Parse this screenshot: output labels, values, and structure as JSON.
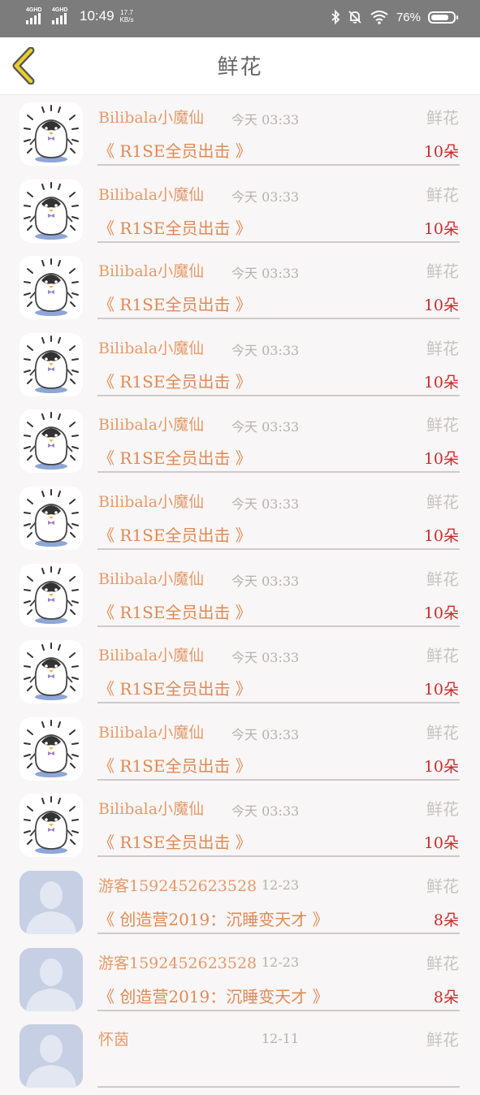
{
  "status_bar": {
    "network_1": "4GHD",
    "network_2": "4GHD",
    "time": "10:49",
    "speed_value": "17.7",
    "speed_unit": "KB/s",
    "battery": "76%"
  },
  "header": {
    "title": "鲜花"
  },
  "items": [
    {
      "name": "Bilibala小魔仙",
      "time": "今天 03:33",
      "kind": "鲜花",
      "show": "《 R1SE全员出击 》",
      "count": "10朵",
      "avatar": "penguin"
    },
    {
      "name": "Bilibala小魔仙",
      "time": "今天 03:33",
      "kind": "鲜花",
      "show": "《 R1SE全员出击 》",
      "count": "10朵",
      "avatar": "penguin"
    },
    {
      "name": "Bilibala小魔仙",
      "time": "今天 03:33",
      "kind": "鲜花",
      "show": "《 R1SE全员出击 》",
      "count": "10朵",
      "avatar": "penguin"
    },
    {
      "name": "Bilibala小魔仙",
      "time": "今天 03:33",
      "kind": "鲜花",
      "show": "《 R1SE全员出击 》",
      "count": "10朵",
      "avatar": "penguin"
    },
    {
      "name": "Bilibala小魔仙",
      "time": "今天 03:33",
      "kind": "鲜花",
      "show": "《 R1SE全员出击 》",
      "count": "10朵",
      "avatar": "penguin"
    },
    {
      "name": "Bilibala小魔仙",
      "time": "今天 03:33",
      "kind": "鲜花",
      "show": "《 R1SE全员出击 》",
      "count": "10朵",
      "avatar": "penguin"
    },
    {
      "name": "Bilibala小魔仙",
      "time": "今天 03:33",
      "kind": "鲜花",
      "show": "《 R1SE全员出击 》",
      "count": "10朵",
      "avatar": "penguin"
    },
    {
      "name": "Bilibala小魔仙",
      "time": "今天 03:33",
      "kind": "鲜花",
      "show": "《 R1SE全员出击 》",
      "count": "10朵",
      "avatar": "penguin"
    },
    {
      "name": "Bilibala小魔仙",
      "time": "今天 03:33",
      "kind": "鲜花",
      "show": "《 R1SE全员出击 》",
      "count": "10朵",
      "avatar": "penguin"
    },
    {
      "name": "Bilibala小魔仙",
      "time": "今天 03:33",
      "kind": "鲜花",
      "show": "《 R1SE全员出击 》",
      "count": "10朵",
      "avatar": "penguin"
    },
    {
      "name": "游客1592452623528",
      "time": "12-23",
      "kind": "鲜花",
      "show": "《 创造营2019：沉睡变天才 》",
      "count": "8朵",
      "avatar": "default-user"
    },
    {
      "name": "游客1592452623528",
      "time": "12-23",
      "kind": "鲜花",
      "show": "《 创造营2019：沉睡变天才 》",
      "count": "8朵",
      "avatar": "default-user"
    },
    {
      "name": "怀茵",
      "time": "12-11",
      "kind": "鲜花",
      "show": "",
      "count": "",
      "avatar": "default-user"
    }
  ]
}
